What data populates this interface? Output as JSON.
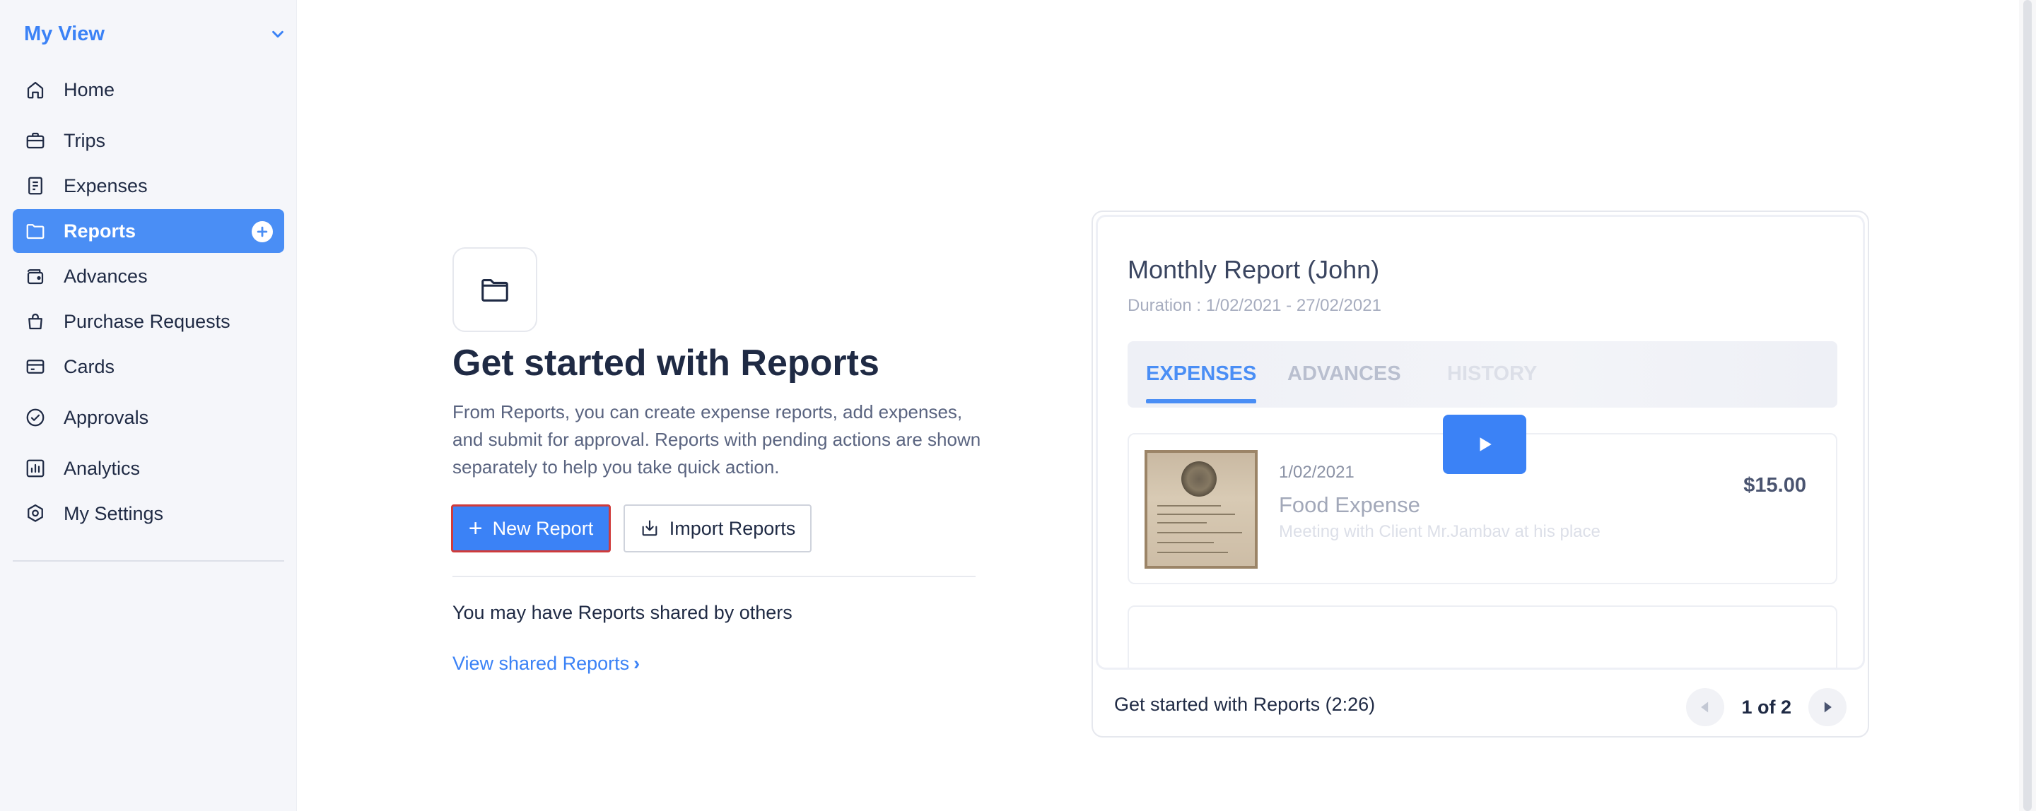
{
  "sidebar": {
    "view_title": "My View",
    "items": [
      {
        "label": "Home",
        "icon": "home-icon"
      },
      {
        "label": "Trips",
        "icon": "briefcase-icon"
      },
      {
        "label": "Expenses",
        "icon": "receipt-icon"
      },
      {
        "label": "Reports",
        "icon": "folder-icon",
        "active": true
      },
      {
        "label": "Advances",
        "icon": "wallet-icon"
      },
      {
        "label": "Purchase Requests",
        "icon": "shopping-bag-icon"
      },
      {
        "label": "Cards",
        "icon": "credit-card-icon"
      },
      {
        "label": "Approvals",
        "icon": "check-circle-icon"
      },
      {
        "label": "Analytics",
        "icon": "chart-icon"
      },
      {
        "label": "My Settings",
        "icon": "settings-icon"
      }
    ]
  },
  "main": {
    "title": "Get started with Reports",
    "description": "From Reports, you can create expense reports, add expenses, and submit for approval. Reports with pending actions are shown separately to help you take quick action.",
    "new_report_label": "New Report",
    "import_reports_label": "Import Reports",
    "shared_text": "You may have Reports shared by others",
    "shared_link": "View shared Reports"
  },
  "video": {
    "report_title": "Monthly Report (John)",
    "duration": "Duration : 1/02/2021 - 27/02/2021",
    "tabs": [
      "EXPENSES",
      "ADVANCES",
      "HISTORY"
    ],
    "expense": {
      "date": "1/02/2021",
      "name": "Food Expense",
      "meta": "Meeting with Client Mr.Jambav at his place",
      "amount": "$15.00"
    },
    "footer_title": "Get started with Reports (2:26)",
    "pager": "1 of 2"
  },
  "colors": {
    "accent": "#3b82f6",
    "active_nav": "#4a8ef5",
    "focus_outline": "#cf3b3b"
  }
}
